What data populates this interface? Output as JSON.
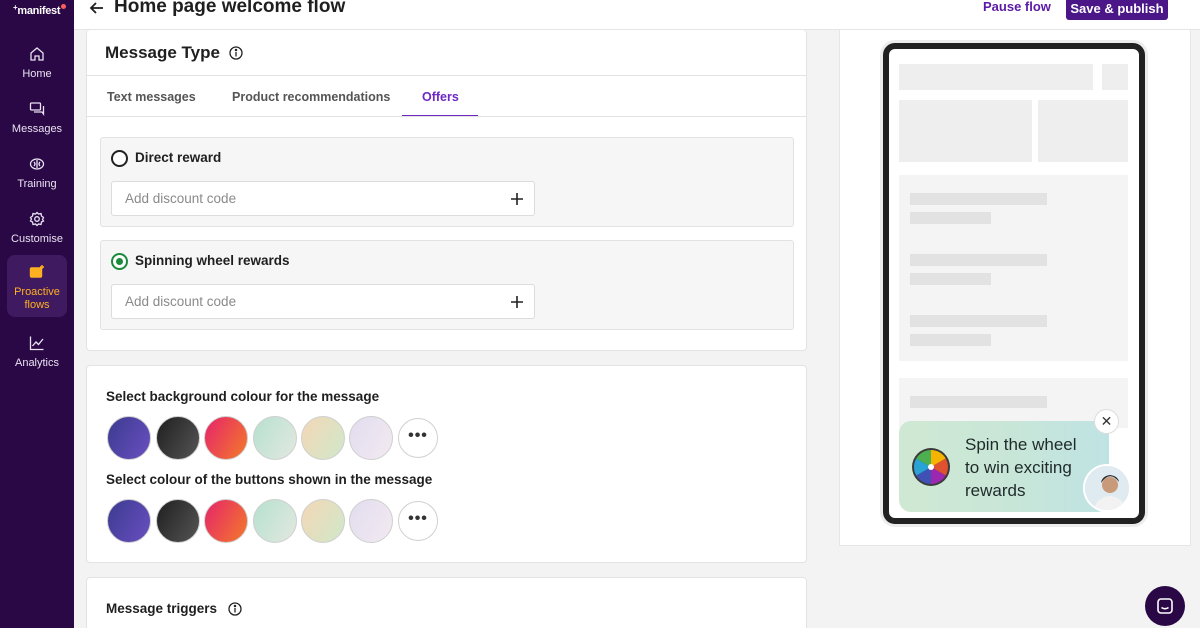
{
  "sidebar": {
    "logo": "manifest",
    "items": [
      {
        "label": "Home",
        "icon": "home-icon"
      },
      {
        "label": "Messages",
        "icon": "messages-icon"
      },
      {
        "label": "Training",
        "icon": "brain-icon"
      },
      {
        "label": "Customise",
        "icon": "gear-icon"
      },
      {
        "label": "Proactive flows",
        "label_line1": "Proactive",
        "label_line2": "flows",
        "icon": "proactive-flows-icon",
        "active": true
      },
      {
        "label": "Analytics",
        "icon": "analytics-icon"
      }
    ]
  },
  "header": {
    "title": "Home page welcome flow",
    "pause_label": "Pause flow",
    "publish_label": "Save & publish"
  },
  "message_type": {
    "title": "Message Type",
    "tabs": [
      {
        "label": "Text messages",
        "active": false
      },
      {
        "label": "Product recommendations",
        "active": false
      },
      {
        "label": "Offers",
        "active": true
      }
    ],
    "options": [
      {
        "label": "Direct reward",
        "selected": false,
        "input_placeholder": "Add discount code"
      },
      {
        "label": "Spinning wheel rewards",
        "selected": true,
        "input_placeholder": "Add discount code"
      }
    ]
  },
  "colours": {
    "background_label": "Select background colour for the message",
    "buttons_label": "Select colour of the buttons shown in the message",
    "swatches": [
      {
        "name": "indigo-purple",
        "gradient": [
          "#3b3b8f",
          "#6a4fc1"
        ]
      },
      {
        "name": "charcoal",
        "gradient": [
          "#1f1f1f",
          "#555555"
        ]
      },
      {
        "name": "pink-orange",
        "gradient": [
          "#e5246a",
          "#f47a2a"
        ]
      },
      {
        "name": "mint",
        "gradient": [
          "#b6e1cf",
          "#e2e8e0"
        ]
      },
      {
        "name": "peach",
        "gradient": [
          "#f4d7b6",
          "#cfe8c9"
        ]
      },
      {
        "name": "lavender",
        "gradient": [
          "#e1dcef",
          "#f3eaf0"
        ]
      }
    ],
    "more_label": "•••"
  },
  "triggers": {
    "title": "Message triggers"
  },
  "preview": {
    "promo_text": "Spin the wheel to win exciting rewards",
    "close_label": "✕"
  },
  "colors": {
    "sidebar_bg": "#2a0845",
    "accent": "#6d28c4",
    "publish_bg": "#4b1688",
    "active_nav": "#ffb020",
    "selected_radio": "#1c8a3d"
  }
}
